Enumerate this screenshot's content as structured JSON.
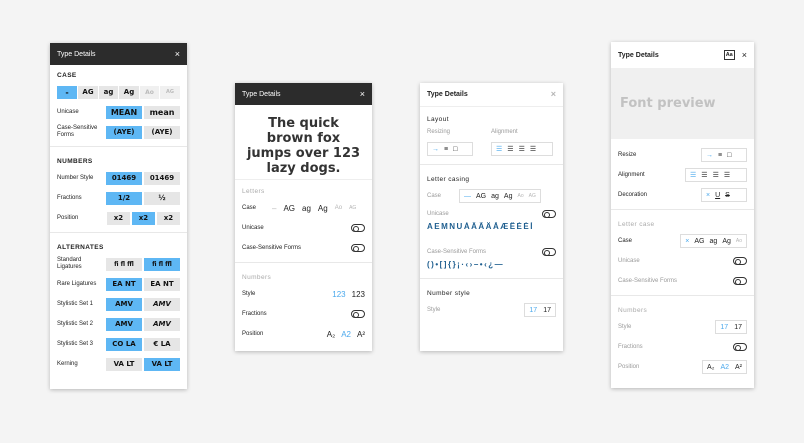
{
  "panel1": {
    "title": "Type Details",
    "close": "×",
    "case": {
      "heading": "CASE",
      "options": [
        "-",
        "AG",
        "ag",
        "Ag",
        "Ao",
        "AG"
      ]
    },
    "unicase": {
      "label": "Unicase",
      "options": [
        "MEAN",
        "mean"
      ]
    },
    "case_sensitive": {
      "label": "Case-Sensitive Forms",
      "options": [
        "(AYE)",
        "(AYE)"
      ]
    },
    "numbers_heading": "NUMBERS",
    "number_style": {
      "label": "Number Style",
      "options": [
        "01469",
        "01469"
      ]
    },
    "fractions": {
      "label": "Fractions",
      "options": [
        "1/2",
        "½"
      ]
    },
    "position": {
      "label": "Position",
      "options": [
        "x2",
        "x2",
        "x2"
      ]
    },
    "alternates_heading": "ALTERNATES",
    "std_lig": {
      "label": "Standard Ligatures",
      "options": [
        "fi fl ffl",
        "fi fl ffl"
      ]
    },
    "rare_lig": {
      "label": "Rare Ligatures",
      "options": [
        "EA NT",
        "EA NT"
      ]
    },
    "ss1": {
      "label": "Stylistic Set 1",
      "options": [
        "AMV",
        "AMV"
      ]
    },
    "ss2": {
      "label": "Stylistic Set 2",
      "options": [
        "AMV",
        "AMV"
      ]
    },
    "ss3": {
      "label": "Stylistic Set 3",
      "options": [
        "CO LA",
        "€ LA"
      ]
    },
    "kerning": {
      "label": "Kerning",
      "options": [
        "VA LT",
        "VA LT"
      ]
    }
  },
  "panel2": {
    "title": "Type Details",
    "close": "×",
    "preview": "The quick brown fox jumps over 123 lazy dogs.",
    "letters_heading": "Letters",
    "case_label": "Case",
    "case_options": [
      "–",
      "AG",
      "ag",
      "Ag",
      "Ao",
      "AG"
    ],
    "unicase_label": "Unicase",
    "csf_label": "Case-Sensitive Forms",
    "numbers_heading": "Numbers",
    "style_label": "Style",
    "style_options": [
      "123",
      "123"
    ],
    "fractions_label": "Fractions",
    "position_label": "Position",
    "position_options": [
      "A₂",
      "A2",
      "A²"
    ]
  },
  "panel3": {
    "title": "Type Details",
    "close": "×",
    "layout_heading": "Layout",
    "resizing_label": "Resizing",
    "alignment_label": "Alignment",
    "letter_casing_heading": "Letter casing",
    "case_label": "Case",
    "case_options": [
      "—",
      "AG",
      "ag",
      "Ag",
      "Ao",
      "AG"
    ],
    "unicase_label": "Unicase",
    "unicase_glyphs": "AEMNUÁÂÃÄÅÆÊÈÉÍ",
    "csf_label": "Case-Sensitive Forms",
    "csf_glyphs": "()•[]{}¡·‹›–•‹¿—",
    "number_style_heading": "Number style",
    "style_label": "Style",
    "style_options": [
      "17",
      "17"
    ]
  },
  "panel4": {
    "title": "Type Details",
    "close": "×",
    "aa_icon": "Aa",
    "preview": "Font preview",
    "resize_label": "Resize",
    "alignment_label": "Alignment",
    "decoration_label": "Decoration",
    "letter_case_heading": "Letter case",
    "case_label": "Case",
    "case_options": [
      "×",
      "AG",
      "ag",
      "Ag",
      "Ao"
    ],
    "unicase_label": "Unicase",
    "csf_label": "Case-Sensitive Forms",
    "numbers_heading": "Numbers",
    "style_label": "Style",
    "style_options": [
      "17",
      "17"
    ],
    "fractions_label": "Fractions",
    "position_label": "Position",
    "position_options": [
      "A₂",
      "A2",
      "A²"
    ]
  },
  "colors": {
    "accent": "#5eb7f4",
    "accent_text": "#4aa8ec",
    "header_dark": "#2c2c2c"
  }
}
